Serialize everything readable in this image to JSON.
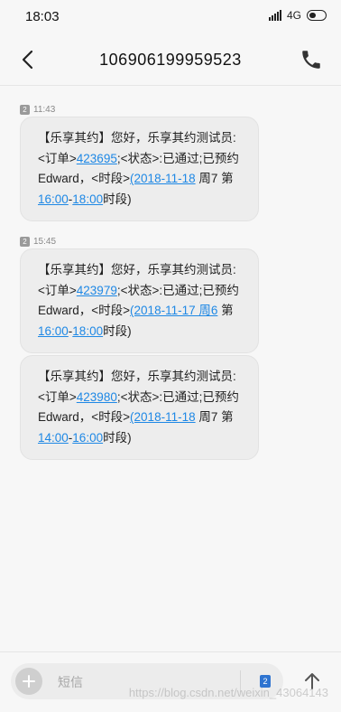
{
  "status_bar": {
    "time": "18:03",
    "network": "4G"
  },
  "header": {
    "title": "106906199959523"
  },
  "messages": [
    {
      "sim": "2",
      "time": "11:43",
      "parts": {
        "p1": "【乐享其约】您好，乐享其约测试员:<订单>",
        "order": "423695",
        "p2": ";<状态>:已通过;已预约Edward，<时段>",
        "date": "(2018-11-18",
        "p3": " 周7 第",
        "t1": "16:00",
        "dash": "-",
        "t2": "18:00",
        "p4": "时段)"
      }
    },
    {
      "sim": "2",
      "time": "15:45",
      "parts": {
        "p1": "【乐享其约】您好，乐享其约测试员:<订单>",
        "order": "423979",
        "p2": ";<状态>:已通过;已预约Edward，<时段>",
        "date": "(2018-11-17 周6",
        "p3": " 第",
        "t1": "16:00",
        "dash": "-",
        "t2": "18:00",
        "p4": "时段)"
      }
    },
    {
      "parts": {
        "p1": "【乐享其约】您好，乐享其约测试员:<订单>",
        "order": "423980",
        "p2": ";<状态>:已通过;已预约Edward，<时段>",
        "date": "(2018-11-18",
        "p3": " 周7 第",
        "t1": "14:00",
        "dash": "-",
        "t2": "16:00",
        "p4": "时段)"
      }
    }
  ],
  "composer": {
    "placeholder": "短信",
    "sim": "2"
  },
  "watermark": "https://blog.csdn.net/weixin_43064143",
  "icons": [
    "back-arrow-icon",
    "phone-icon",
    "plus-icon",
    "send-arrow-icon"
  ],
  "colors": {
    "link": "#1e88e5",
    "bubble": "#ededed",
    "sim_active": "#2f74d0"
  }
}
